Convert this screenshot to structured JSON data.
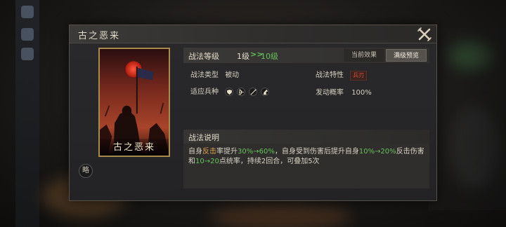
{
  "dialog": {
    "title": "古之恶来",
    "close_icon": "close-x-icon"
  },
  "card": {
    "name": "古之恶来",
    "skip_label": "略"
  },
  "level": {
    "label": "战法等级",
    "from": "1级",
    "arrows": ">>",
    "to": "10级"
  },
  "tabs": {
    "current": "当前效果",
    "max": "满级预览",
    "selected": "满级预览"
  },
  "attributes": {
    "type_label": "战法类型",
    "type_value": "被动",
    "trait_label": "战法特性",
    "trait_value": "兵刃",
    "units_label": "适应兵种",
    "units": [
      "shield-icon",
      "bow-icon",
      "spear-icon",
      "horse-icon"
    ],
    "rate_label": "发动概率",
    "rate_value": "100%"
  },
  "description": {
    "title": "战法说明",
    "parts": [
      {
        "t": "自身",
        "c": ""
      },
      {
        "t": "反击",
        "c": "orange"
      },
      {
        "t": "率提升",
        "c": ""
      },
      {
        "t": "30%→60%",
        "c": "green"
      },
      {
        "t": "，自身受到伤害后提升自身",
        "c": ""
      },
      {
        "t": "10%→20%",
        "c": "green"
      },
      {
        "t": "反击伤害和",
        "c": ""
      },
      {
        "t": "10→20",
        "c": "green"
      },
      {
        "t": "点统率，持续2回合，可叠加5次",
        "c": ""
      }
    ]
  },
  "colors": {
    "accent_green": "#63c25a",
    "accent_orange": "#e0a24a",
    "trait_red": "#d94a3a",
    "card_border": "#a88a4a"
  }
}
